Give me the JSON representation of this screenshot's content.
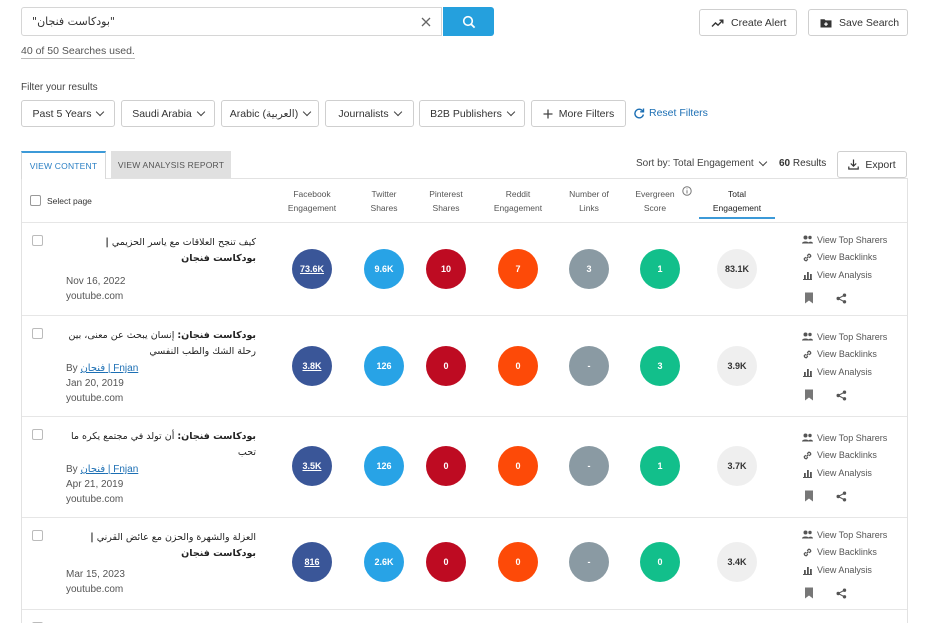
{
  "search": {
    "query": "\"بودكاست فنجان\"",
    "used": "40 of 50 Searches used."
  },
  "top_actions": {
    "create_alert": "Create Alert",
    "save_search": "Save Search"
  },
  "filters": {
    "label": "Filter your results",
    "items": [
      "Past 5 Years",
      "Saudi Arabia",
      "Arabic (العربية)",
      "Journalists",
      "B2B Publishers"
    ],
    "more": "More Filters",
    "reset": "Reset Filters"
  },
  "tabs": {
    "view_content": "VIEW CONTENT",
    "view_analysis": "VIEW ANALYSIS REPORT"
  },
  "sort": {
    "label": "Sort by: Total Engagement",
    "results_count": "60",
    "results_word": "Results",
    "export": "Export"
  },
  "table": {
    "select_page": "Select page",
    "columns": [
      {
        "l1": "Facebook",
        "l2": "Engagement"
      },
      {
        "l1": "Twitter",
        "l2": "Shares"
      },
      {
        "l1": "Pinterest",
        "l2": "Shares"
      },
      {
        "l1": "Reddit",
        "l2": "Engagement"
      },
      {
        "l1": "Number of",
        "l2": "Links"
      },
      {
        "l1": "Evergreen",
        "l2": "Score"
      },
      {
        "l1": "Total",
        "l2": "Engagement"
      }
    ],
    "actions": {
      "top_sharers": "View Top Sharers",
      "backlinks": "View Backlinks",
      "analysis": "View Analysis"
    },
    "rows": [
      {
        "title": "كيف تنجح العلاقات مع ياسر الحزيمي",
        "title_bold": "| بودكاست فنجان",
        "by": "",
        "author": "",
        "date": "Nov 16, 2022",
        "domain": "youtube.com",
        "metrics": [
          "73.6K",
          "9.6K",
          "10",
          "7",
          "3",
          "1",
          "83.1K"
        ]
      },
      {
        "title": "إنسان يبحث عن معنى، بين رحلة الشك والطب النفسي",
        "title_bold": "بودكاست فنجان:",
        "by": "By",
        "author": "فنجان | Fnjan",
        "date": "Jan 20, 2019",
        "domain": "youtube.com",
        "metrics": [
          "3.8K",
          "126",
          "0",
          "0",
          "-",
          "3",
          "3.9K"
        ]
      },
      {
        "title": "أن تولد في مجتمع يكره ما تحب ￼￼",
        "title_bold": "بودكاست فنجان:",
        "by": "By",
        "author": "فنجان | Fnjan",
        "date": "Apr 21, 2019",
        "domain": "youtube.com",
        "metrics": [
          "3.5K",
          "126",
          "0",
          "0",
          "-",
          "1",
          "3.7K"
        ]
      },
      {
        "title": "العزلة والشهرة والحزن مع عائض القرني",
        "title_bold": "| بودكاست فنجان",
        "by": "",
        "author": "",
        "date": "Mar 15, 2023",
        "domain": "youtube.com",
        "metrics": [
          "816",
          "2.6K",
          "0",
          "0",
          "-",
          "0",
          "3.4K"
        ]
      }
    ]
  },
  "colors": {
    "facebook": "#3a5698",
    "twitter": "#28a3e6",
    "pinterest": "#be0b22",
    "reddit": "#fd4a08",
    "links": "#8a9aa3",
    "evergreen": "#12bf8b",
    "total": "#efefef",
    "accent": "#25a0dd"
  }
}
